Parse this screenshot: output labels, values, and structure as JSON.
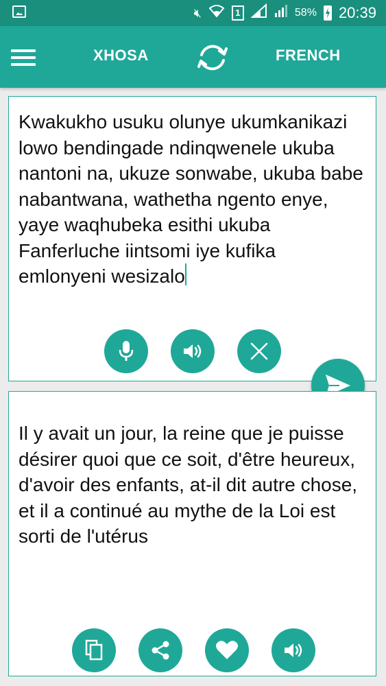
{
  "status_bar": {
    "battery_percent": "58%",
    "time": "20:39",
    "sim_slot": "1"
  },
  "header": {
    "source_language": "XHOSA",
    "target_language": "FRENCH"
  },
  "input": {
    "text": "Kwakukho usuku olunye ukumkanikazi lowo bendingade ndinqwenele ukuba nantoni na, ukuze sonwabe, ukuba babe nabantwana, wathetha ngento enye, yaye waqhubeka esithi ukuba Fanferluche iintsomi iye kufika emlonyeni wesizalo"
  },
  "output": {
    "text": "Il y avait un jour, la reine que je puisse désirer quoi que ce soit, d'être heureux, d'avoir des enfants, at-il dit autre chose, et il a continué au mythe de la Loi est sorti de l'utérus"
  },
  "icons": {
    "menu": "hamburger-icon",
    "swap": "swap-icon",
    "mic": "microphone-icon",
    "speaker": "speaker-icon",
    "clear": "close-icon",
    "send": "send-icon",
    "copy": "copy-icon",
    "share": "share-icon",
    "favorite": "heart-icon"
  },
  "colors": {
    "accent": "#1fa898",
    "status_bar": "#1a8f7e",
    "background": "#ececec"
  }
}
